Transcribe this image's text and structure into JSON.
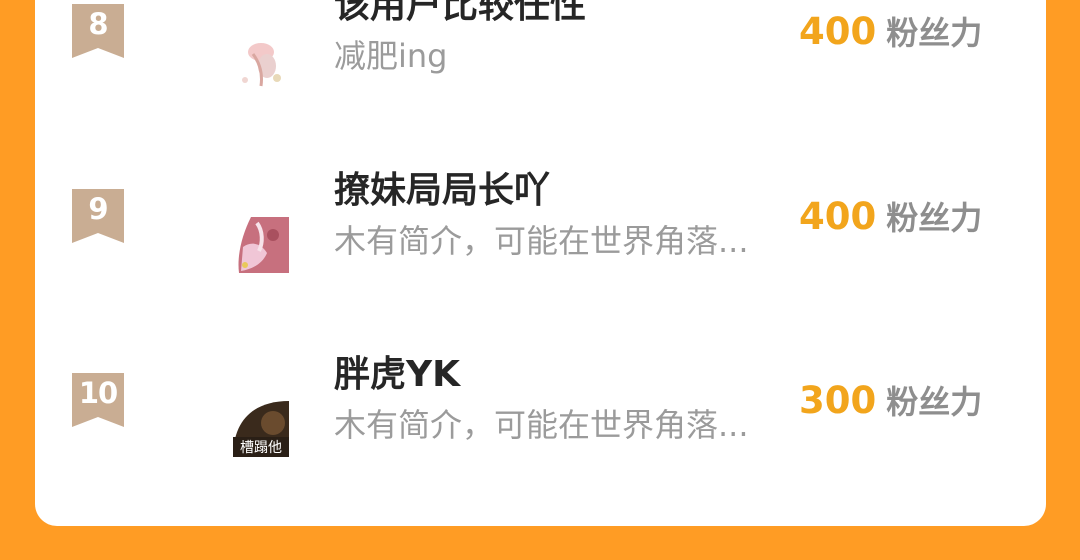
{
  "leaderboard": {
    "rows": [
      {
        "rank": "8",
        "name": "该用户比较任性",
        "bio": "减肥ing",
        "score": "400",
        "unit": "粉丝力",
        "badge_color": "#C9AD93",
        "avatar_icon": "pink-floral-avatar-icon"
      },
      {
        "rank": "9",
        "name": "撩妹局局长吖",
        "bio": "木有简介，可能在世界角落...",
        "score": "400",
        "unit": "粉丝力",
        "badge_color": "#C9AD93",
        "avatar_icon": "anime-girl-avatar-icon"
      },
      {
        "rank": "10",
        "name": "胖虎YK",
        "bio": "木有简介，可能在世界角落...",
        "score": "300",
        "unit": "粉丝力",
        "badge_color": "#C9AD93",
        "avatar_icon": "video-still-avatar-icon",
        "avatar_text": "槽蹋他"
      }
    ]
  },
  "colors": {
    "background": "#FF9C24",
    "score": "#F2A51C",
    "name": "#262626",
    "bio": "#9b9b9b"
  }
}
